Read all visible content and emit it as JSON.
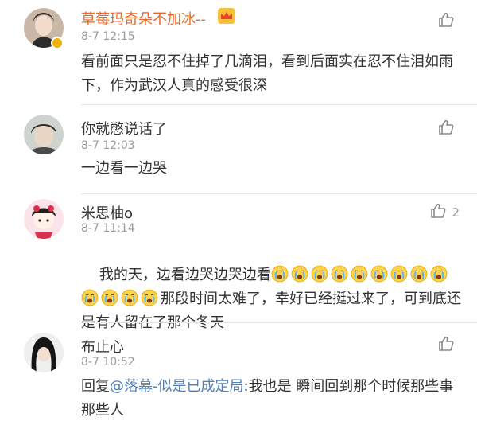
{
  "comments": [
    {
      "username": "草莓玛奇朵不加冰--",
      "timestamp": "8-7 12:15",
      "text": "看前面只是忍不住掉了几滴泪，看到后面实在忍不住泪如雨下，作为武汉人真的感受很深",
      "like_count": ""
    },
    {
      "username": "你就憋说话了",
      "timestamp": "8-7 12:03",
      "text": "一边看一边哭",
      "like_count": ""
    },
    {
      "username": "米思柚o",
      "timestamp": "8-7 11:14",
      "text_prefix": "我的天，边看边哭边哭边看",
      "text_suffix": "那段时间太难了，幸好已经挺过来了，可到底还是有人留在了那个冬天",
      "like_count": "2"
    },
    {
      "username": "布止心",
      "timestamp": "8-7 10:52",
      "reply_prefix": "回复",
      "mention": "@落幕-似是已成定局",
      "reply_text": ":我也是 瞬间回到那个时候那些事 那些人",
      "like_count": ""
    }
  ],
  "icons": {
    "like": "thumbs-up-icon",
    "crown": "crown-badge-icon",
    "cry": "crying-face-emoji",
    "verified": "verified-badge-icon"
  },
  "colors": {
    "vip_username": "#e86a26",
    "mention": "#4f7fb8",
    "meta": "#9a9a9a"
  }
}
